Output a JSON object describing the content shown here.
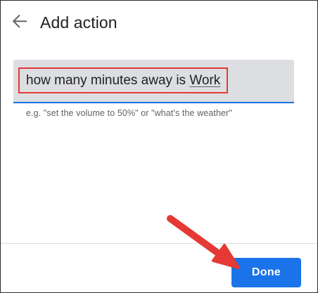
{
  "header": {
    "title": "Add action",
    "back_icon": "arrow-back-icon"
  },
  "input": {
    "text_before": "how many minutes away is ",
    "text_link": "Work",
    "helper": "e.g. \"set the volume to 50%\" or \"what's the weather\""
  },
  "footer": {
    "done_label": "Done"
  },
  "colors": {
    "accent": "#1a73e8",
    "annotation_red": "#e53935",
    "input_background": "#dddee1"
  }
}
